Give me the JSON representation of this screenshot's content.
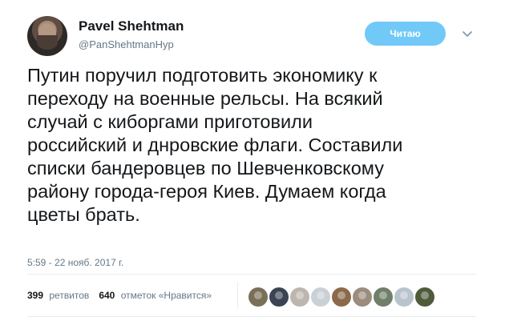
{
  "author": {
    "name": "Pavel Shehtman",
    "handle": "@PanShehtmanHyp",
    "avatar_icon": "user-avatar"
  },
  "follow_button": {
    "label": "Читаю"
  },
  "tweet": {
    "lines": [
      "Путин поручил подготовить экономику к",
      "переходу на военные рельсы. На всякий",
      "случай с киборгами приготовили",
      "российский и днровские флаги. Составили",
      "списки бандеровцев по Шевченковскому",
      "району города-героя Киев. Думаем когда",
      "цветы брать."
    ],
    "timestamp": "5:59 - 22 нояб. 2017 г."
  },
  "stats": {
    "retweets_count": "399",
    "retweets_label": "ретвитов",
    "likes_count": "640",
    "likes_label": "отметок «Нравится»"
  },
  "likers": [
    {
      "color": "#7a6f57"
    },
    {
      "color": "#3b4452"
    },
    {
      "color": "#bdb6ae"
    },
    {
      "color": "#c9d0d6"
    },
    {
      "color": "#8a6a4a"
    },
    {
      "color": "#9b8c7d"
    },
    {
      "color": "#6f7f6a"
    },
    {
      "color": "#b8c4cc"
    },
    {
      "color": "#4e5b3a"
    }
  ],
  "colors": {
    "follow_button": "#71c9f8",
    "secondary_text": "#657786",
    "primary_text": "#14171a"
  }
}
